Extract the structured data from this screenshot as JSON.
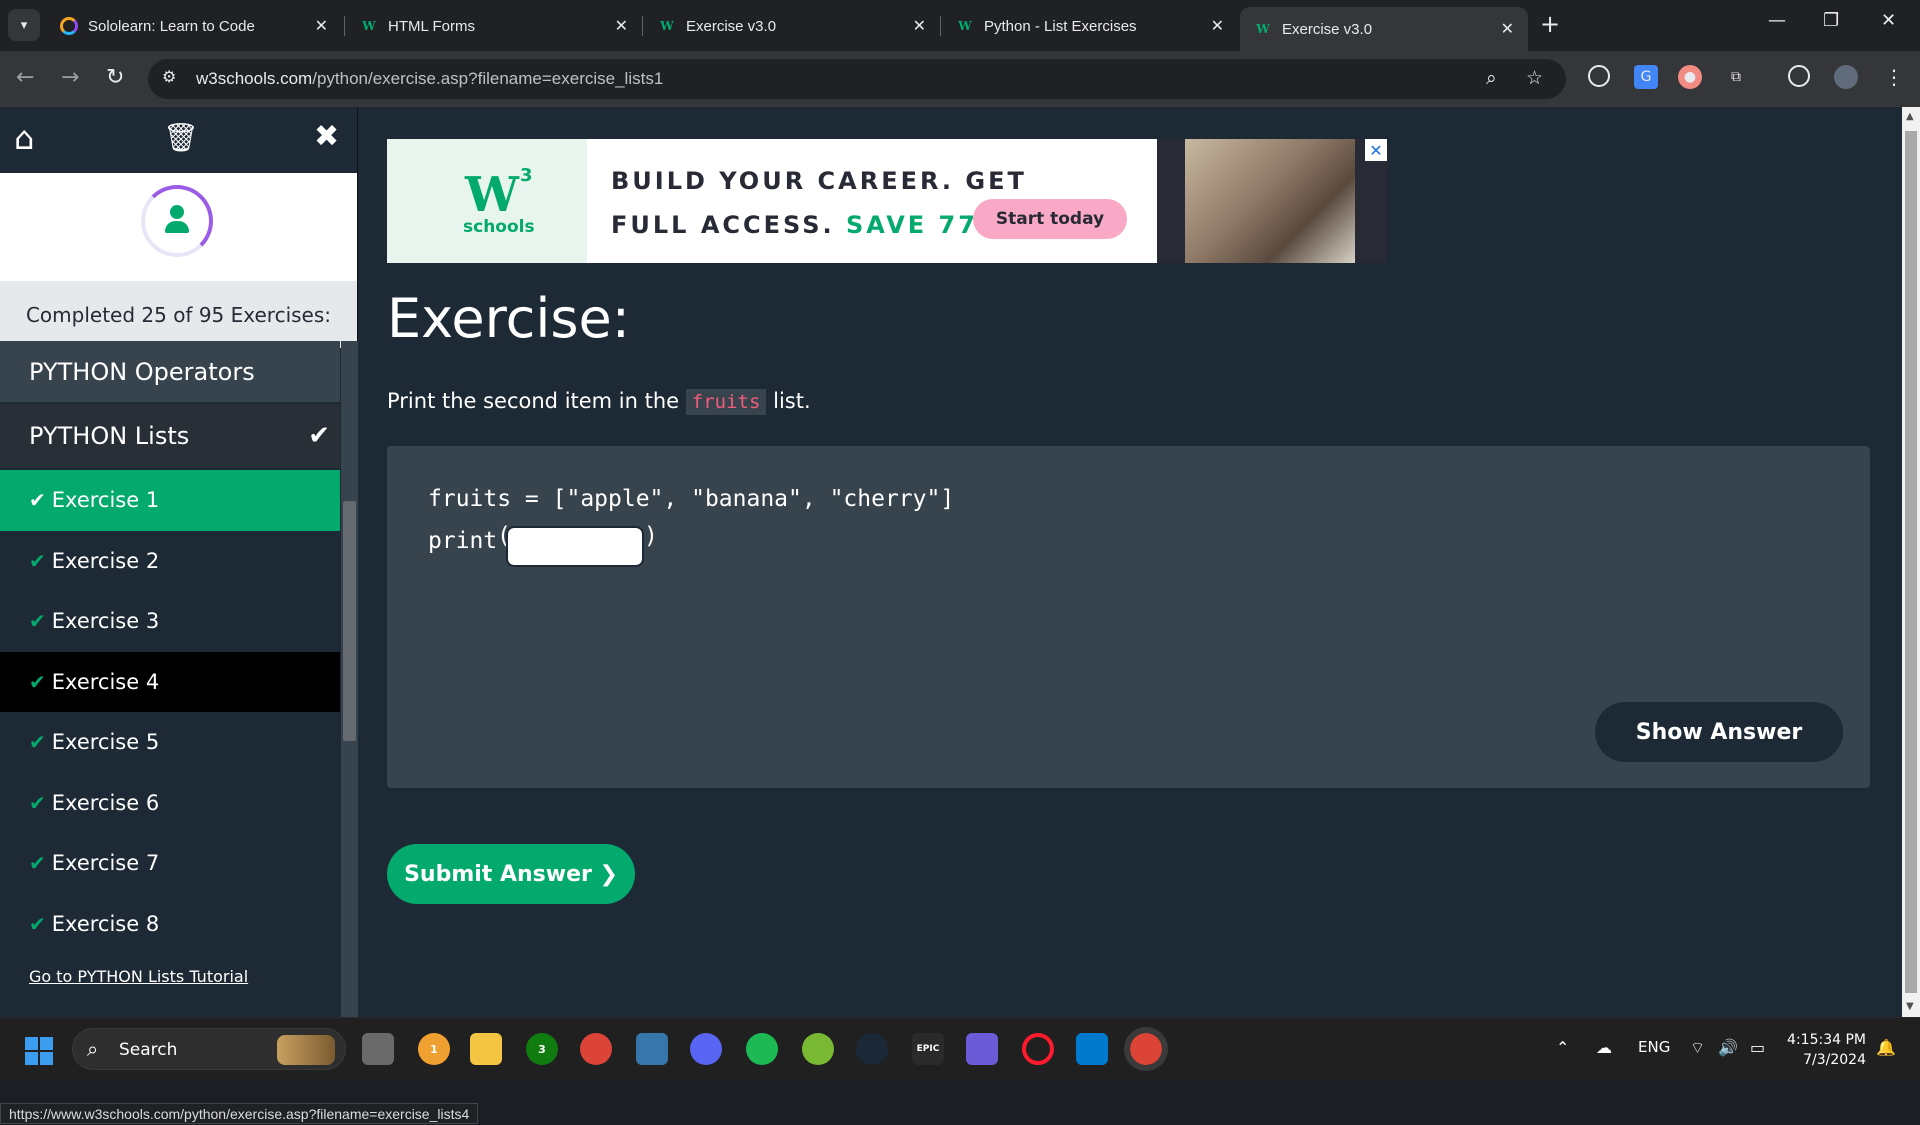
{
  "browser": {
    "tabs": [
      {
        "title": "Sololearn: Learn to Code",
        "active": false
      },
      {
        "title": "HTML Forms",
        "active": false
      },
      {
        "title": "Exercise v3.0",
        "active": false
      },
      {
        "title": "Python - List Exercises",
        "active": false
      },
      {
        "title": "Exercise v3.0",
        "active": true
      }
    ],
    "url_domain": "w3schools.com",
    "url_path": "/python/exercise.asp?filename=exercise_lists1",
    "status_url": "https://www.w3schools.com/python/exercise.asp?filename=exercise_lists4"
  },
  "sidebar": {
    "progress_text": "Completed 25 of 95 Exercises:",
    "categories": [
      {
        "label": "PYTHON Operators"
      },
      {
        "label": "PYTHON Lists"
      }
    ],
    "exercises": [
      {
        "label": "Exercise 1"
      },
      {
        "label": "Exercise 2"
      },
      {
        "label": "Exercise 3"
      },
      {
        "label": "Exercise 4"
      },
      {
        "label": "Exercise 5"
      },
      {
        "label": "Exercise 6"
      },
      {
        "label": "Exercise 7"
      },
      {
        "label": "Exercise 8"
      }
    ],
    "tutorial_link": "Go to PYTHON Lists Tutorial"
  },
  "ad": {
    "logo_mark": "W",
    "logo_sup": "3",
    "logo_text": "schools",
    "line1": "BUILD YOUR CAREER. GET",
    "line2_prefix": "FULL ACCESS.",
    "line2_highlight": "SAVE 770$",
    "cta": "Start today"
  },
  "exercise": {
    "heading": "Exercise:",
    "instruction_prefix": "Print the second item in the",
    "instruction_code": "fruits",
    "instruction_suffix": "list.",
    "code_line1": "fruits = [\"apple\", \"banana\", \"cherry\"]",
    "code_line2_prefix": "print",
    "show_answer": "Show Answer",
    "submit": "Submit Answer ❯"
  },
  "taskbar": {
    "search_label": "Search",
    "language": "ENG",
    "time": "4:15:34 PM",
    "date": "7/3/2024",
    "badges": {
      "weather": "1",
      "xbox": "3"
    }
  },
  "colors": {
    "accent": "#04aa6d",
    "page_bg": "#1d2a35",
    "code_bg": "#38444d",
    "code_keyword": "#f15c7a"
  }
}
